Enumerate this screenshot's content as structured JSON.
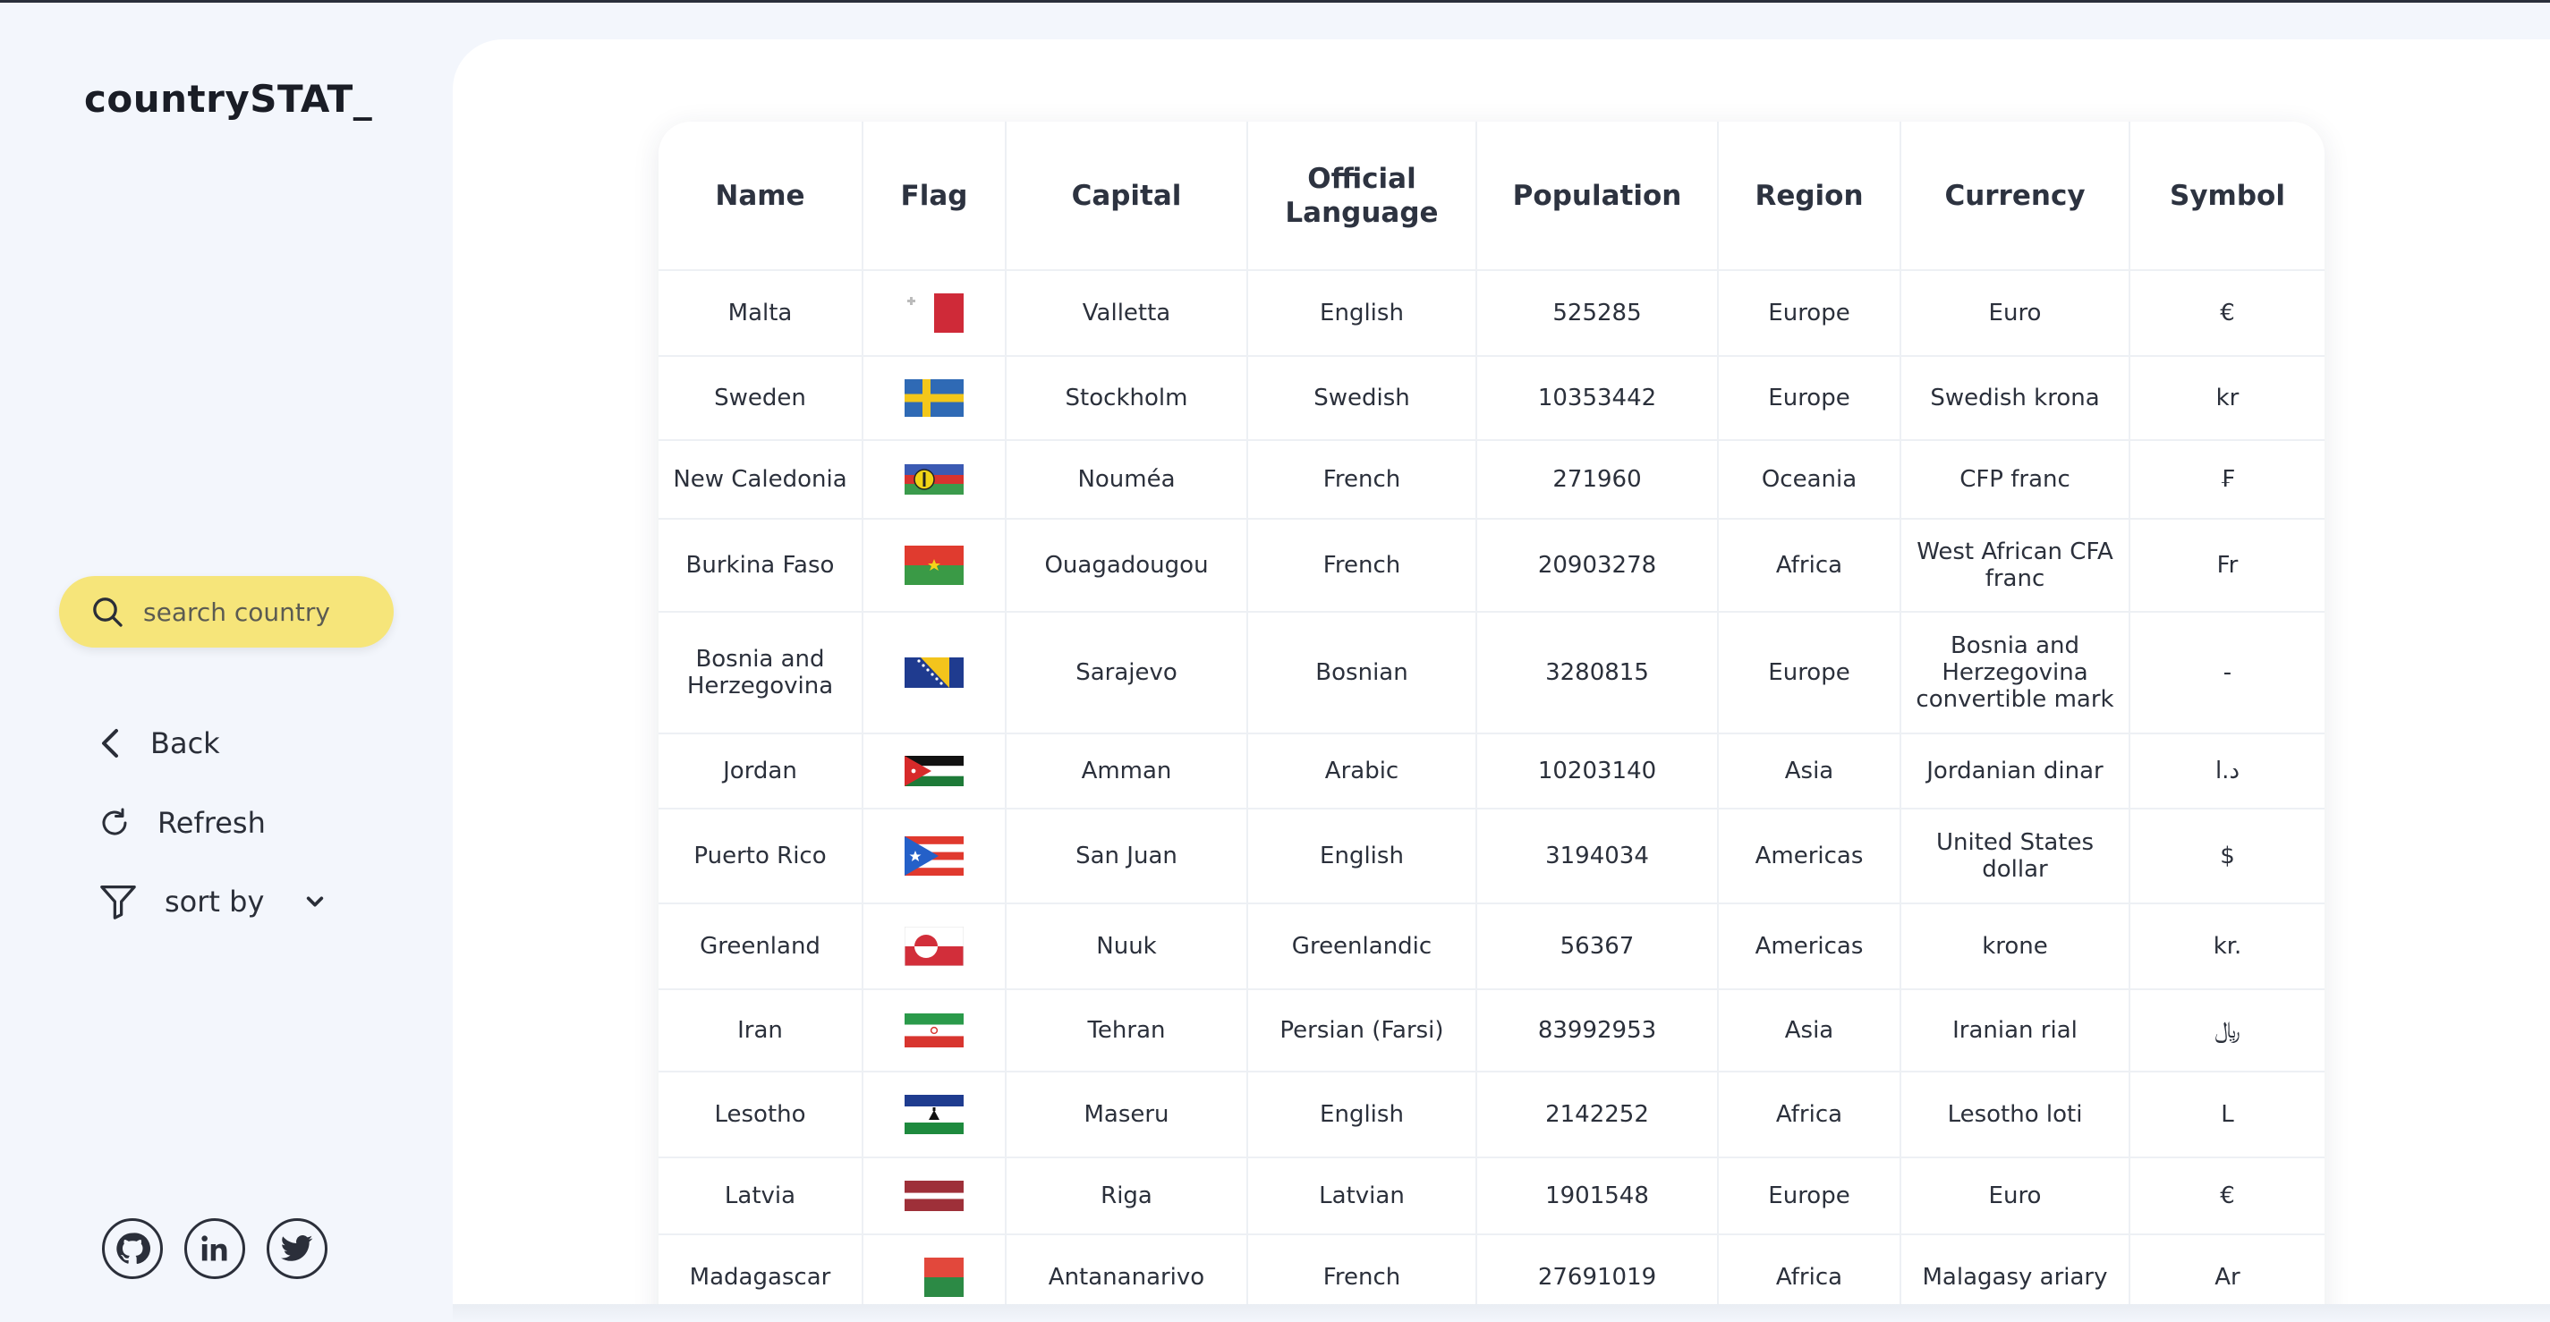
{
  "app": {
    "logo": "countrySTAT_"
  },
  "sidebar": {
    "search_placeholder": "search country",
    "back_label": "Back",
    "refresh_label": "Refresh",
    "sort_label": "sort by"
  },
  "socials": [
    "github-icon",
    "linkedin-icon",
    "twitter-icon"
  ],
  "table": {
    "headers": [
      "Name",
      "Flag",
      "Capital",
      "Official Language",
      "Population",
      "Region",
      "Currency",
      "Symbol"
    ],
    "rows": [
      {
        "name": "Malta",
        "flag": "malta",
        "capital": "Valletta",
        "language": "English",
        "population": "525285",
        "region": "Europe",
        "currency": "Euro",
        "symbol": "€"
      },
      {
        "name": "Sweden",
        "flag": "sweden",
        "capital": "Stockholm",
        "language": "Swedish",
        "population": "10353442",
        "region": "Europe",
        "currency": "Swedish krona",
        "symbol": "kr"
      },
      {
        "name": "New Caledonia",
        "flag": "new-caledonia",
        "capital": "Nouméa",
        "language": "French",
        "population": "271960",
        "region": "Oceania",
        "currency": "CFP franc",
        "symbol": "₣"
      },
      {
        "name": "Burkina Faso",
        "flag": "burkina-faso",
        "capital": "Ouagadougou",
        "language": "French",
        "population": "20903278",
        "region": "Africa",
        "currency": "West African CFA franc",
        "symbol": "Fr"
      },
      {
        "name": "Bosnia and Herzegovina",
        "flag": "bosnia",
        "capital": "Sarajevo",
        "language": "Bosnian",
        "population": "3280815",
        "region": "Europe",
        "currency": "Bosnia and Herzegovina convertible mark",
        "symbol": "-"
      },
      {
        "name": "Jordan",
        "flag": "jordan",
        "capital": "Amman",
        "language": "Arabic",
        "population": "10203140",
        "region": "Asia",
        "currency": "Jordanian dinar",
        "symbol": "د.ا"
      },
      {
        "name": "Puerto Rico",
        "flag": "puerto-rico",
        "capital": "San Juan",
        "language": "English",
        "population": "3194034",
        "region": "Americas",
        "currency": "United States dollar",
        "symbol": "$"
      },
      {
        "name": "Greenland",
        "flag": "greenland",
        "capital": "Nuuk",
        "language": "Greenlandic",
        "population": "56367",
        "region": "Americas",
        "currency": "krone",
        "symbol": "kr."
      },
      {
        "name": "Iran",
        "flag": "iran",
        "capital": "Tehran",
        "language": "Persian (Farsi)",
        "population": "83992953",
        "region": "Asia",
        "currency": "Iranian rial",
        "symbol": "﷼"
      },
      {
        "name": "Lesotho",
        "flag": "lesotho",
        "capital": "Maseru",
        "language": "English",
        "population": "2142252",
        "region": "Africa",
        "currency": "Lesotho loti",
        "symbol": "L"
      },
      {
        "name": "Latvia",
        "flag": "latvia",
        "capital": "Riga",
        "language": "Latvian",
        "population": "1901548",
        "region": "Europe",
        "currency": "Euro",
        "symbol": "€"
      },
      {
        "name": "Madagascar",
        "flag": "madagascar",
        "capital": "Antananarivo",
        "language": "French",
        "population": "27691019",
        "region": "Africa",
        "currency": "Malagasy ariary",
        "symbol": "Ar"
      }
    ]
  }
}
